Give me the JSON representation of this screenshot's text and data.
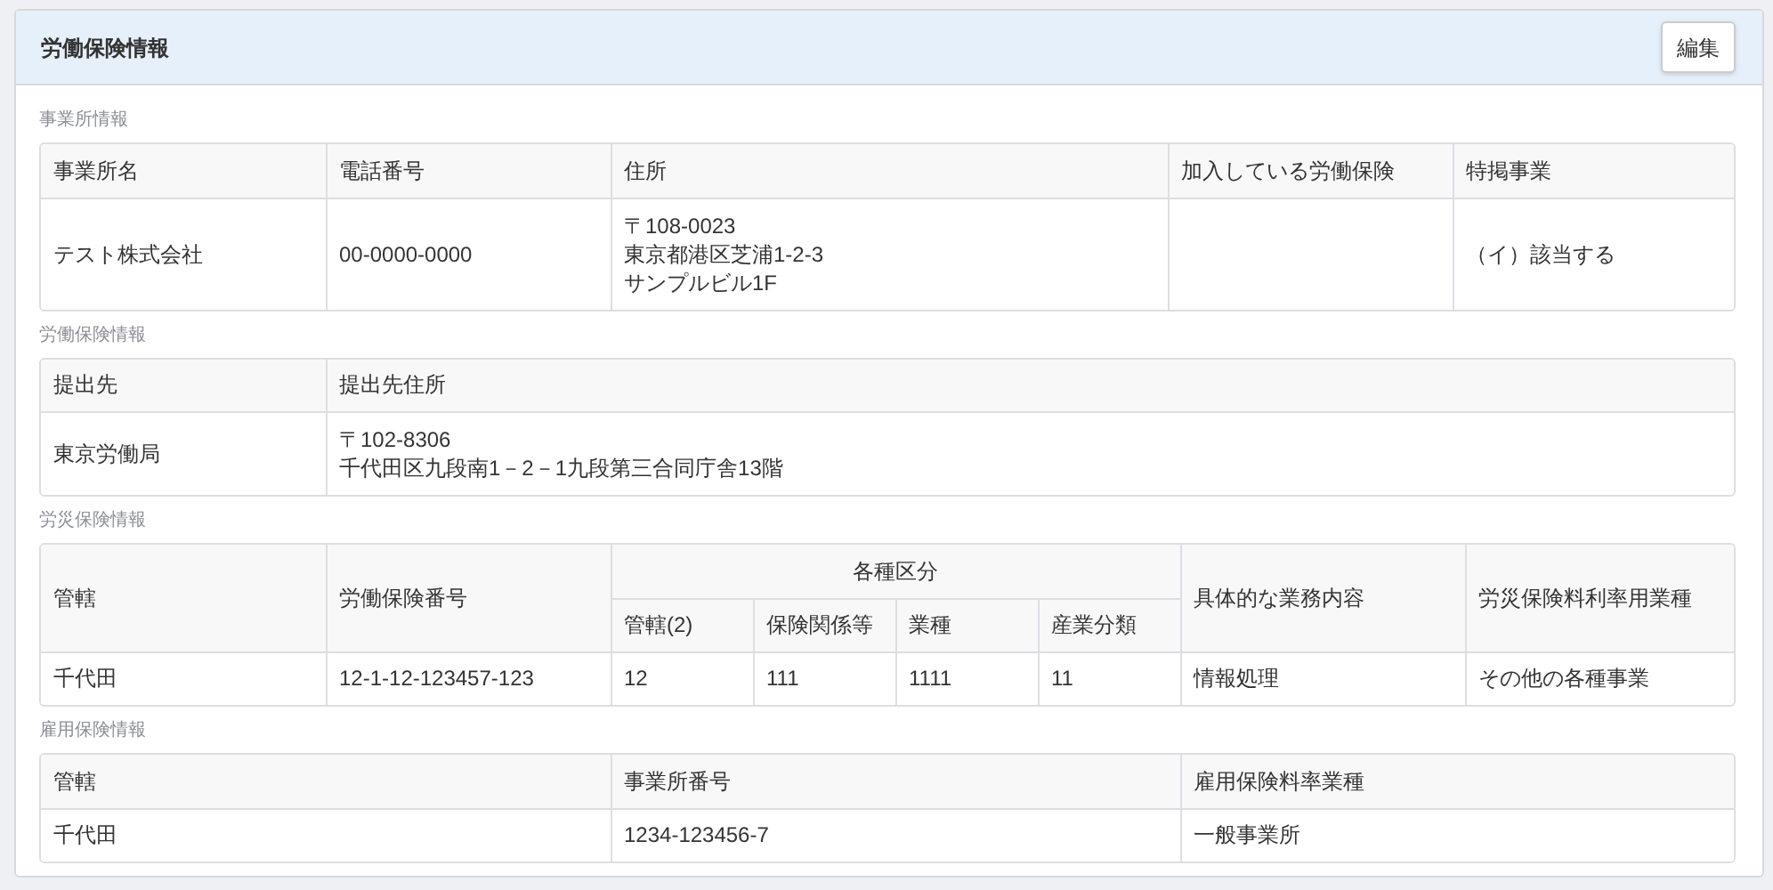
{
  "panel": {
    "title": "労働保険情報",
    "edit_button": "編集"
  },
  "sections": [
    {
      "title": "事業所情報",
      "columns": [
        {
          "label": "事業所名"
        },
        {
          "label": "電話番号"
        },
        {
          "label": "住所"
        },
        {
          "label": "加入している労働保険"
        },
        {
          "label": "特掲事業"
        }
      ],
      "rows": [
        [
          "テスト株式会社",
          "00-0000-0000",
          "〒108-0023\n東京都港区芝浦1-2-3\nサンプルビル1F",
          null,
          "（イ）該当する"
        ]
      ]
    },
    {
      "title": "労働保険情報",
      "columns": [
        {
          "label": "提出先"
        },
        {
          "label": "提出先住所"
        }
      ],
      "rows": [
        [
          "東京労働局",
          "〒102-8306\n千代田区九段南1－2－1九段第三合同庁舎13階"
        ]
      ]
    },
    {
      "title": "労災保険情報",
      "columns": [
        {
          "label": "管轄"
        },
        {
          "label": "労働保険番号"
        },
        {
          "label": "各種区分",
          "colspan": 4,
          "children": [
            {
              "label": "管轄(2)"
            },
            {
              "label": "保険関係等"
            },
            {
              "label": "業種"
            },
            {
              "label": "産業分類"
            }
          ]
        },
        {
          "label": "具体的な業務内容"
        },
        {
          "label": "労災保険料利率用業種"
        }
      ],
      "rows": [
        [
          "千代田",
          "12-1-12-123457-123",
          "12",
          "111",
          "1111",
          "11",
          "情報処理",
          "その他の各種事業"
        ]
      ]
    },
    {
      "title": "雇用保険情報",
      "columns": [
        {
          "label": "管轄"
        },
        {
          "label": "事業所番号"
        },
        {
          "label": "雇用保険料率業種"
        }
      ],
      "rows": [
        [
          "千代田",
          "1234-123456-7",
          "一般事業所"
        ]
      ]
    }
  ]
}
